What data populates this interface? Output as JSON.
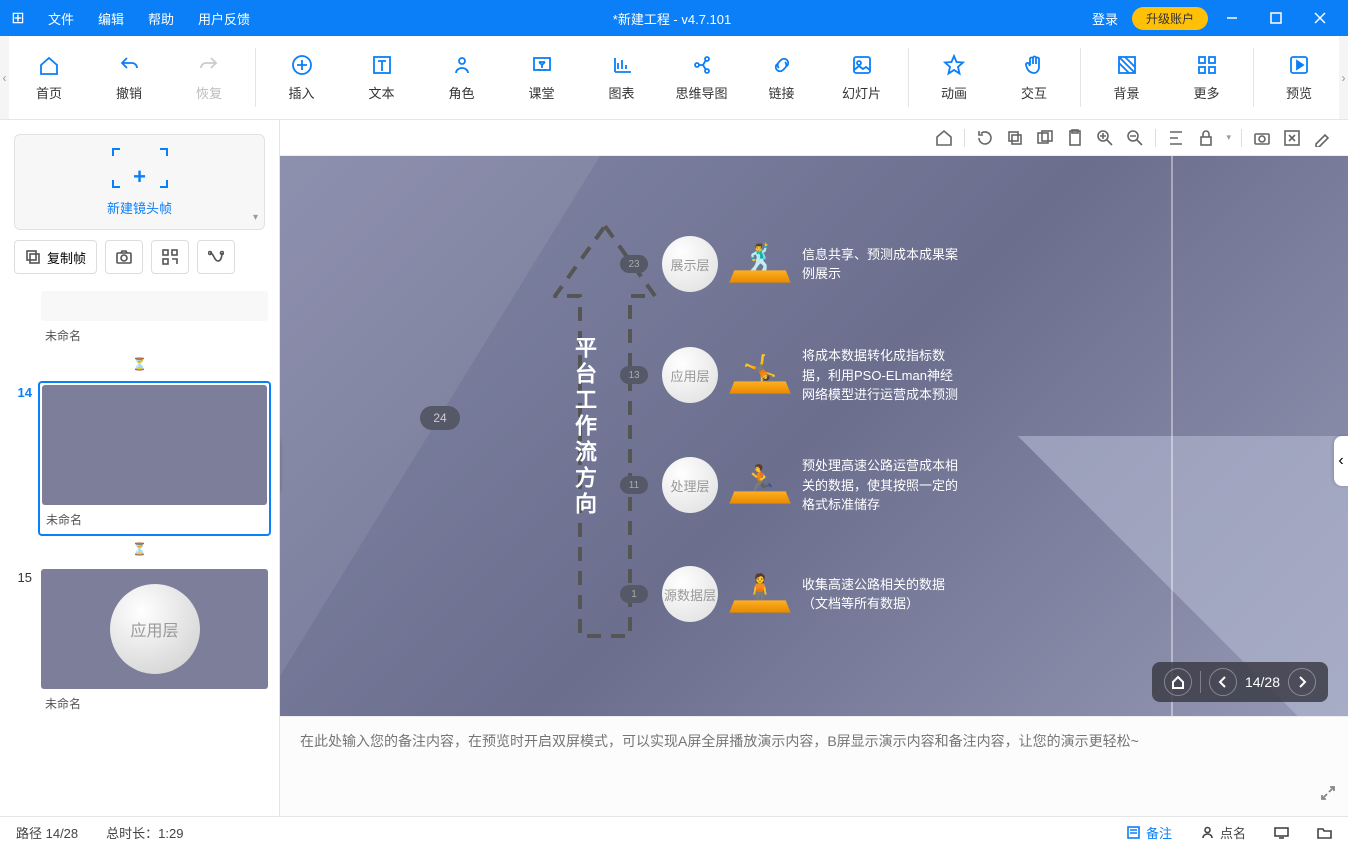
{
  "titlebar": {
    "menus": [
      "文件",
      "编辑",
      "帮助",
      "用户反馈"
    ],
    "title": "*新建工程 - v4.7.101",
    "login": "登录",
    "upgrade": "升级账户"
  },
  "toolbar": {
    "items": [
      {
        "label": "首页",
        "icon": "home"
      },
      {
        "label": "撤销",
        "icon": "undo"
      },
      {
        "label": "恢复",
        "icon": "redo",
        "disabled": true
      }
    ],
    "items2": [
      {
        "label": "插入",
        "icon": "plus-circle"
      },
      {
        "label": "文本",
        "icon": "text"
      },
      {
        "label": "角色",
        "icon": "user"
      },
      {
        "label": "课堂",
        "icon": "board"
      },
      {
        "label": "图表",
        "icon": "chart"
      },
      {
        "label": "思维导图",
        "icon": "mindmap"
      },
      {
        "label": "链接",
        "icon": "link"
      },
      {
        "label": "幻灯片",
        "icon": "slide"
      }
    ],
    "items3": [
      {
        "label": "动画",
        "icon": "star"
      },
      {
        "label": "交互",
        "icon": "hand"
      }
    ],
    "items4": [
      {
        "label": "背景",
        "icon": "bg"
      },
      {
        "label": "更多",
        "icon": "grid"
      }
    ],
    "items5": [
      {
        "label": "预览",
        "icon": "play"
      }
    ]
  },
  "sidebar": {
    "new_frame_label": "新建镜头帧",
    "copy_frame": "复制帧",
    "thumbs": [
      {
        "num": "",
        "title": "未命名",
        "kind": "curve"
      },
      {
        "num": "14",
        "title": "未命名",
        "kind": "diagram",
        "selected": true
      },
      {
        "num": "15",
        "title": "未命名",
        "kind": "large",
        "circle_label": "应用层"
      }
    ]
  },
  "canvas": {
    "badge24": "24",
    "vert_title": "平台工作流方向",
    "layers": [
      {
        "badge": "23",
        "circle": "展示层",
        "desc": "信息共享、预测成本成果案例展示"
      },
      {
        "badge": "13",
        "circle": "应用层",
        "desc": "将成本数据转化成指标数据，利用PSO-ELman神经网络模型进行运营成本预测"
      },
      {
        "badge": "11",
        "circle": "处理层",
        "desc": "预处理高速公路运营成本相关的数据，使其按照一定的格式标准储存"
      },
      {
        "badge": "1",
        "circle": "源数据层",
        "desc": "收集高速公路相关的数据（文档等所有数据）"
      }
    ],
    "nav_counter": "14/28"
  },
  "notes": {
    "placeholder": "在此处输入您的备注内容，在预览时开启双屏模式，可以实现A屏全屏播放演示内容，B屏显示演示内容和备注内容，让您的演示更轻松~"
  },
  "statusbar": {
    "path": "路径 14/28",
    "duration": "总时长：1:29",
    "notes_btn": "备注",
    "roll_btn": "点名"
  }
}
